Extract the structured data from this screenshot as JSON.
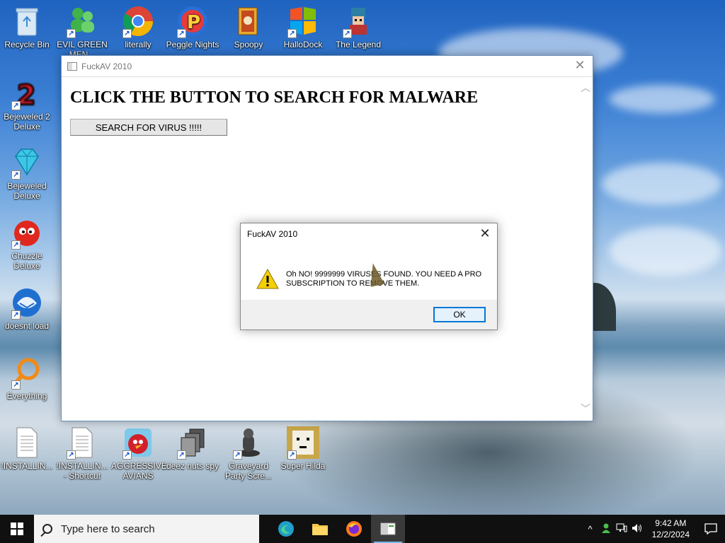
{
  "desktop": {
    "icons": [
      {
        "label": "Recycle Bin"
      },
      {
        "label": "EVIL GREEN MEN..."
      },
      {
        "label": "literally"
      },
      {
        "label": "Peggle Nights"
      },
      {
        "label": "Spoopy"
      },
      {
        "label": "HalloDock"
      },
      {
        "label": "The Legend"
      },
      {
        "label": "Bejeweled 2 Deluxe"
      },
      {
        "label": "Bejeweled Deluxe"
      },
      {
        "label": "Chuzzle Deluxe"
      },
      {
        "label": "doesnt load"
      },
      {
        "label": "Everything"
      },
      {
        "label": "!INSTALLIN..."
      },
      {
        "label": "!INSTALLIN... - Shortcut"
      },
      {
        "label": "AGGRESSIVE AVIANS"
      },
      {
        "label": "deez nuts spy"
      },
      {
        "label": "Graveyard Party Scre..."
      },
      {
        "label": "Super Hilda"
      }
    ]
  },
  "main_window": {
    "title": "FuckAV 2010",
    "headline": "CLICK THE BUTTON TO SEARCH FOR MALWARE",
    "button_label": "SEARCH FOR VIRUS !!!!!"
  },
  "dialog": {
    "title": "FuckAV 2010",
    "message": "Oh NO! 9999999 VIRUSES FOUND. YOU NEED A PRO SUBSCRIPTION TO REMOVE THEM.",
    "ok_label": "OK"
  },
  "taskbar": {
    "search_placeholder": "Type here to search",
    "time": "9:42 AM",
    "date": "12/2/2024"
  },
  "colors": {
    "accent": "#0078d7",
    "taskbar": "#101010",
    "warning": "#f5d000"
  }
}
